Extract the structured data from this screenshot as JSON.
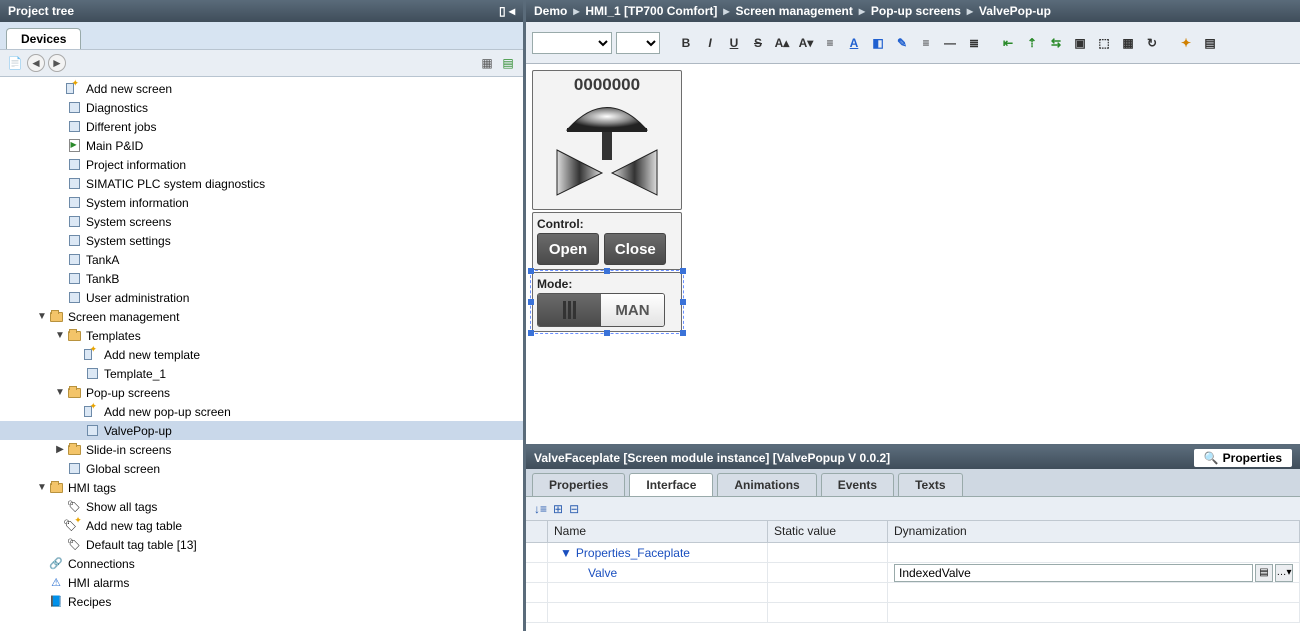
{
  "left": {
    "title": "Project tree",
    "tab": "Devices"
  },
  "tree": [
    {
      "indent": 3,
      "icon": "sq-star",
      "label": "Add new screen"
    },
    {
      "indent": 3,
      "icon": "sq",
      "label": "Diagnostics"
    },
    {
      "indent": 3,
      "icon": "sq",
      "label": "Different jobs"
    },
    {
      "indent": 3,
      "icon": "greendoc",
      "label": "Main P&ID"
    },
    {
      "indent": 3,
      "icon": "sq",
      "label": "Project information"
    },
    {
      "indent": 3,
      "icon": "sq",
      "label": "SIMATIC PLC system diagnostics"
    },
    {
      "indent": 3,
      "icon": "sq",
      "label": "System information"
    },
    {
      "indent": 3,
      "icon": "sq",
      "label": "System screens"
    },
    {
      "indent": 3,
      "icon": "sq",
      "label": "System settings"
    },
    {
      "indent": 3,
      "icon": "sq",
      "label": "TankA"
    },
    {
      "indent": 3,
      "icon": "sq",
      "label": "TankB"
    },
    {
      "indent": 3,
      "icon": "sq",
      "label": "User administration"
    },
    {
      "indent": 2,
      "tw": "▼",
      "icon": "folder",
      "label": "Screen management"
    },
    {
      "indent": 3,
      "tw": "▼",
      "icon": "folder",
      "label": "Templates"
    },
    {
      "indent": 4,
      "icon": "sq-star",
      "label": "Add new template"
    },
    {
      "indent": 4,
      "icon": "sq",
      "label": "Template_1"
    },
    {
      "indent": 3,
      "tw": "▼",
      "icon": "folder",
      "label": "Pop-up screens"
    },
    {
      "indent": 4,
      "icon": "sq-star",
      "label": "Add new pop-up screen"
    },
    {
      "indent": 4,
      "icon": "sq",
      "label": "ValvePop-up",
      "selected": true
    },
    {
      "indent": 3,
      "tw": "▶",
      "icon": "folder",
      "label": "Slide-in screens"
    },
    {
      "indent": 3,
      "icon": "sq",
      "label": "Global screen"
    },
    {
      "indent": 2,
      "tw": "▼",
      "icon": "folder",
      "label": "HMI tags"
    },
    {
      "indent": 3,
      "icon": "tag",
      "label": "Show all tags"
    },
    {
      "indent": 3,
      "icon": "tag-star",
      "label": "Add new tag table"
    },
    {
      "indent": 3,
      "icon": "tag",
      "label": "Default tag table [13]"
    },
    {
      "indent": 2,
      "icon": "conn",
      "label": "Connections"
    },
    {
      "indent": 2,
      "icon": "alarm",
      "label": "HMI alarms"
    },
    {
      "indent": 2,
      "icon": "recipe",
      "label": "Recipes"
    }
  ],
  "breadcrumb": [
    "Demo",
    "HMI_1 [TP700 Comfort]",
    "Screen management",
    "Pop-up screens",
    "ValvePop-up"
  ],
  "faceplate": {
    "id": "0000000",
    "control_label": "Control:",
    "open": "Open",
    "close": "Close",
    "mode_label": "Mode:",
    "mode_value": "MAN"
  },
  "inspector": {
    "title": "ValveFaceplate [Screen module instance] [ValvePopup V 0.0.2]",
    "right_tab": "Properties",
    "tabs": [
      "Properties",
      "Interface",
      "Animations",
      "Events",
      "Texts"
    ],
    "active_tab": 1,
    "cols": [
      "Name",
      "Static value",
      "Dynamization"
    ],
    "rows": {
      "group": "Properties_Faceplate",
      "item": "Valve",
      "dyn": "IndexedValve"
    }
  }
}
